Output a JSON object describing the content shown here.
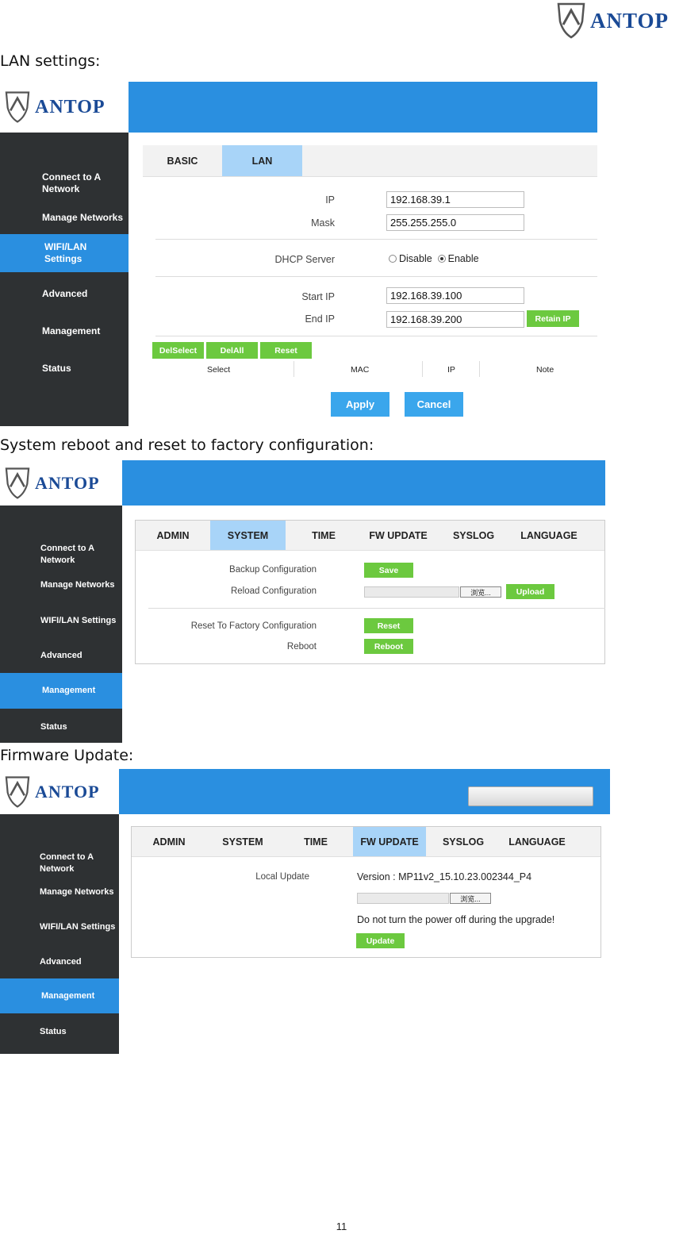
{
  "brand": "ANTOP",
  "page_number": "11",
  "captions": {
    "lan": "LAN settings:",
    "system": "System reboot and reset to factory configuration:",
    "firmware": "Firmware Update:"
  },
  "lan_shot": {
    "sidebar": [
      {
        "label": "Connect to A Network",
        "active": false
      },
      {
        "label": "Manage Networks",
        "active": false
      },
      {
        "label": "WIFI/LAN Settings",
        "active": true
      },
      {
        "label": "Advanced",
        "active": false
      },
      {
        "label": "Management",
        "active": false
      },
      {
        "label": "Status",
        "active": false
      }
    ],
    "tabs": [
      {
        "label": "BASIC",
        "active": false
      },
      {
        "label": "LAN",
        "active": true
      }
    ],
    "ip_label": "IP",
    "ip_value": "192.168.39.1",
    "mask_label": "Mask",
    "mask_value": "255.255.255.0",
    "dhcp_label": "DHCP Server",
    "dhcp_disable": "Disable",
    "dhcp_enable": "Enable",
    "dhcp_selected": "Enable",
    "start_ip_label": "Start IP",
    "start_ip_value": "192.168.39.100",
    "end_ip_label": "End IP",
    "end_ip_value": "192.168.39.200",
    "retain_ip": "Retain IP",
    "del_select": "DelSelect",
    "del_all": "DelAll",
    "reset": "Reset",
    "columns": [
      "Select",
      "MAC",
      "IP",
      "Note"
    ],
    "apply": "Apply",
    "cancel": "Cancel"
  },
  "system_shot": {
    "sidebar": [
      {
        "label": "Connect to A Network",
        "active": false
      },
      {
        "label": "Manage Networks",
        "active": false
      },
      {
        "label": "WIFI/LAN Settings",
        "active": false
      },
      {
        "label": "Advanced",
        "active": false
      },
      {
        "label": "Management",
        "active": true
      },
      {
        "label": "Status",
        "active": false
      }
    ],
    "tabs": [
      {
        "label": "ADMIN",
        "active": false
      },
      {
        "label": "SYSTEM",
        "active": true
      },
      {
        "label": "TIME",
        "active": false
      },
      {
        "label": "FW UPDATE",
        "active": false
      },
      {
        "label": "SYSLOG",
        "active": false
      },
      {
        "label": "LANGUAGE",
        "active": false
      }
    ],
    "backup_label": "Backup Configuration",
    "save": "Save",
    "reload_label": "Reload Configuration",
    "browse": "浏览...",
    "upload": "Upload",
    "factory_label": "Reset To Factory Configuration",
    "reset": "Reset",
    "reboot_label": "Reboot",
    "reboot": "Reboot"
  },
  "firmware_shot": {
    "sidebar": [
      {
        "label": "Connect to A Network",
        "active": false
      },
      {
        "label": "Manage Networks",
        "active": false
      },
      {
        "label": "WIFI/LAN Settings",
        "active": false
      },
      {
        "label": "Advanced",
        "active": false
      },
      {
        "label": "Management",
        "active": true
      },
      {
        "label": "Status",
        "active": false
      }
    ],
    "tabs": [
      {
        "label": "ADMIN",
        "active": false
      },
      {
        "label": "SYSTEM",
        "active": false
      },
      {
        "label": "TIME",
        "active": false
      },
      {
        "label": "FW UPDATE",
        "active": true
      },
      {
        "label": "SYSLOG",
        "active": false
      },
      {
        "label": "LANGUAGE",
        "active": false
      }
    ],
    "local_update_label": "Local Update",
    "version": "Version : MP11v2_15.10.23.002344_P4",
    "browse": "浏览...",
    "warning": "Do not turn the power off during the upgrade!",
    "update": "Update"
  },
  "colors": {
    "accent_blue": "#2a8fe0",
    "sidebar_dark": "#2e3133",
    "button_green": "#6cc93f",
    "tab_active": "#a8d4f8",
    "brand_navy": "#1a4a96"
  }
}
